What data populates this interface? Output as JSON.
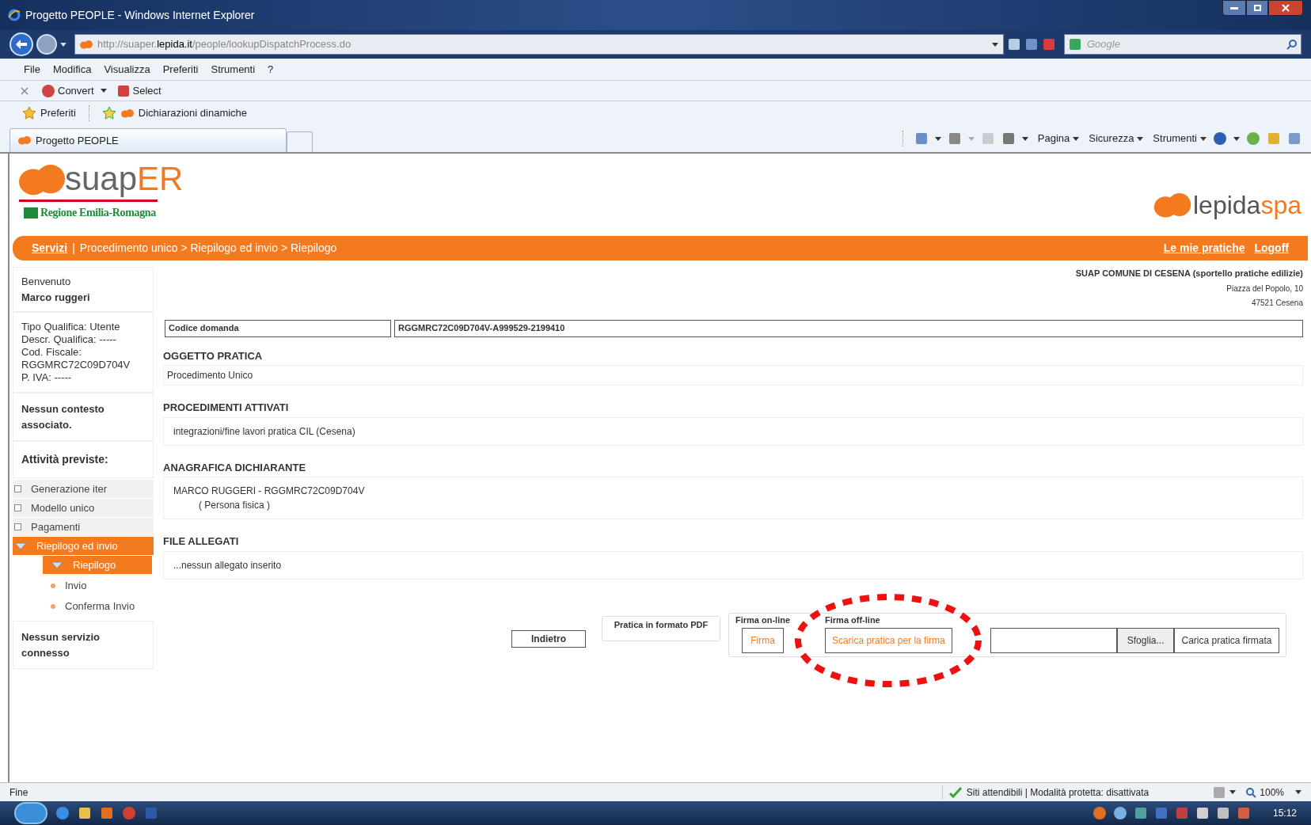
{
  "window": {
    "title": "Progetto PEOPLE - Windows Internet Explorer"
  },
  "address_bar": {
    "url_prefix": "http://suaper.",
    "url_domain": "lepida.it",
    "url_path": "/people/lookupDispatchProcess.do",
    "search_placeholder": "Google"
  },
  "menu": [
    "File",
    "Modifica",
    "Visualizza",
    "Preferiti",
    "Strumenti",
    "?"
  ],
  "toolbar": {
    "convert": "Convert",
    "select": "Select"
  },
  "favorites_bar": {
    "favorites": "Preferiti",
    "link": "Dichiarazioni dinamiche"
  },
  "tabs": [
    {
      "label": "Progetto PEOPLE",
      "selected": true
    }
  ],
  "command_bar": [
    "Pagina",
    "Sicurezza",
    "Strumenti"
  ],
  "page": {
    "logo_text_gray": "suap",
    "logo_text_orange": "ER",
    "region": "Regione Emilia-Romagna",
    "partner_gray": "lepida",
    "partner_orange": "spa",
    "breadcrumb": {
      "link": "Servizi",
      "separator": "|",
      "path": "Procedimento unico > Riepilogo ed invio > Riepilogo",
      "right_links": [
        "Le mie pratiche",
        "Logoff"
      ]
    },
    "sidebar": {
      "welcome": "Benvenuto",
      "user": "Marco ruggeri",
      "info": [
        "Tipo Qualifica: Utente",
        "Descr. Qualifica: -----",
        "Cod. Fiscale:",
        "RGGMRC72C09D704V",
        "P. IVA: -----"
      ],
      "context": "Nessun contesto associato.",
      "activities_title": "Attività previste:",
      "items": [
        {
          "label": "Generazione iter",
          "kind": "checkbox",
          "selected": false
        },
        {
          "label": "Modello unico",
          "kind": "checkbox",
          "selected": false
        },
        {
          "label": "Pagamenti",
          "kind": "checkbox",
          "selected": false
        },
        {
          "label": "Riepilogo ed invio",
          "kind": "expander",
          "selected": true,
          "children": [
            {
              "label": "Riepilogo",
              "kind": "expander",
              "selected": true
            },
            {
              "label": "Invio",
              "kind": "bullet",
              "selected": false
            },
            {
              "label": "Conferma Invio",
              "kind": "bullet",
              "selected": false
            }
          ]
        }
      ],
      "service": "Nessun servizio connesso"
    },
    "office": {
      "name": "SUAP COMUNE DI CESENA (sportello pratiche edilizie)",
      "address": "Piazza del Popolo, 10",
      "city": "47521 Cesena"
    },
    "code": {
      "label": "Codice domanda",
      "value": "RGGMRC72C09D704V-A999529-2199410"
    },
    "sections": [
      {
        "title": "OGGETTO PRATICA",
        "lines": [
          "Procedimento Unico"
        ]
      },
      {
        "title": "PROCEDIMENTI ATTIVATI",
        "lines": [
          "integrazioni/fine lavori pratica CIL (Cesena)"
        ]
      },
      {
        "title": "ANAGRAFICA DICHIARANTE",
        "lines": [
          "MARCO RUGGERI - RGGMRC72C09D704V",
          "( Persona fisica )"
        ]
      },
      {
        "title": "FILE ALLEGATI",
        "lines": [
          "...nessun allegato inserito"
        ]
      }
    ],
    "actions": {
      "back": "Indietro",
      "pdf": "Pratica in formato PDF",
      "online_label": "Firma on-line",
      "online_button": "Firma",
      "offline_label": "Firma off-line",
      "offline_button": "Scarica pratica per la firma",
      "browse": "Sfoglia...",
      "upload": "Carica pratica firmata"
    }
  },
  "status_bar": {
    "text": "Fine",
    "zone": "Siti attendibili | Modalità protetta: disattivata",
    "zoom": "100%"
  },
  "taskbar": {
    "clock": "15:12"
  }
}
